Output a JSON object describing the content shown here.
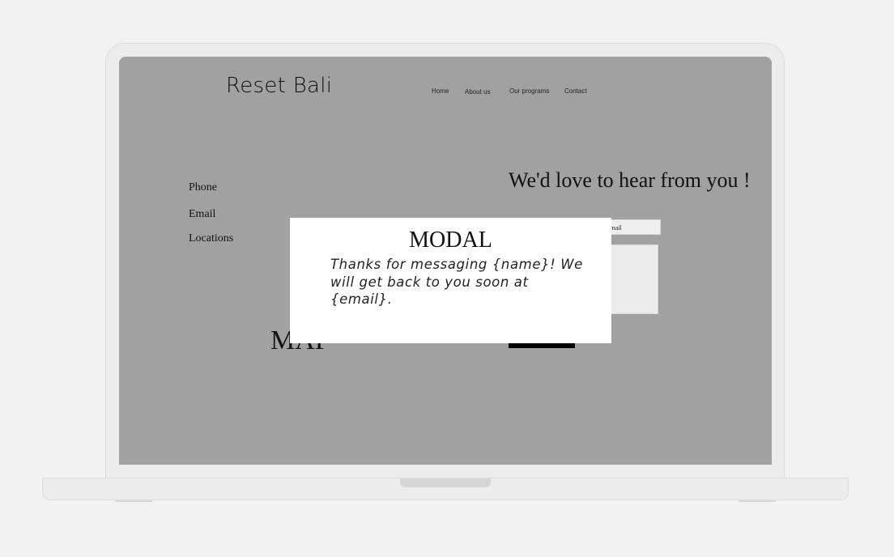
{
  "site": {
    "logo": "Reset Bali"
  },
  "nav": [
    {
      "label": "Home"
    },
    {
      "label": "About us"
    },
    {
      "label": "Our programs"
    },
    {
      "label": "Contact"
    }
  ],
  "contact_info": {
    "phone": "Phone",
    "email": "Email",
    "locations": "Locations"
  },
  "map": {
    "label": "MAP"
  },
  "form": {
    "heading": "We'd love to hear from you !",
    "email_placeholder": "email",
    "message_placeholder": "",
    "submit_label": ""
  },
  "modal": {
    "title": "MODAL",
    "message": "Thanks for messaging {name}! We will get back to you soon at {email}."
  }
}
